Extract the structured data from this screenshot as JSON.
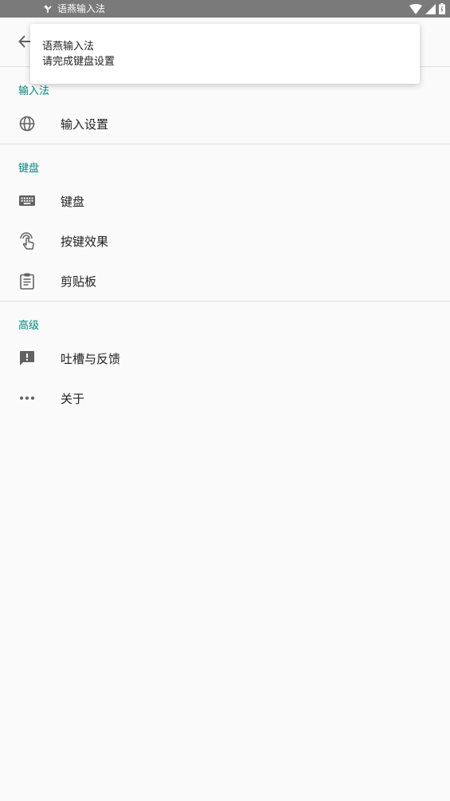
{
  "status_bar": {
    "app_name": "语燕输入法",
    "icons": [
      "app-notification-icon",
      "wifi-icon",
      "signal-icon",
      "battery-icon"
    ]
  },
  "toast": {
    "title": "语燕输入法",
    "message": "请完成键盘设置"
  },
  "sections": {
    "input_method": {
      "header": "输入法",
      "items": {
        "input_settings": {
          "label": "输入设置",
          "icon": "globe-icon"
        }
      }
    },
    "keyboard": {
      "header": "键盘",
      "items": {
        "keyboard": {
          "label": "键盘",
          "icon": "keyboard-icon"
        },
        "key_effects": {
          "label": "按键效果",
          "icon": "touch-icon"
        },
        "clipboard": {
          "label": "剪贴板",
          "icon": "clipboard-icon"
        }
      }
    },
    "advanced": {
      "header": "高级",
      "items": {
        "feedback": {
          "label": "吐槽与反馈",
          "icon": "feedback-icon"
        },
        "about": {
          "label": "关于",
          "icon": "more-horizontal-icon"
        }
      }
    }
  },
  "colors": {
    "accent": "#00897b",
    "status_bar": "#7a7a7a",
    "background": "#fafafa",
    "icon": "#616161"
  }
}
